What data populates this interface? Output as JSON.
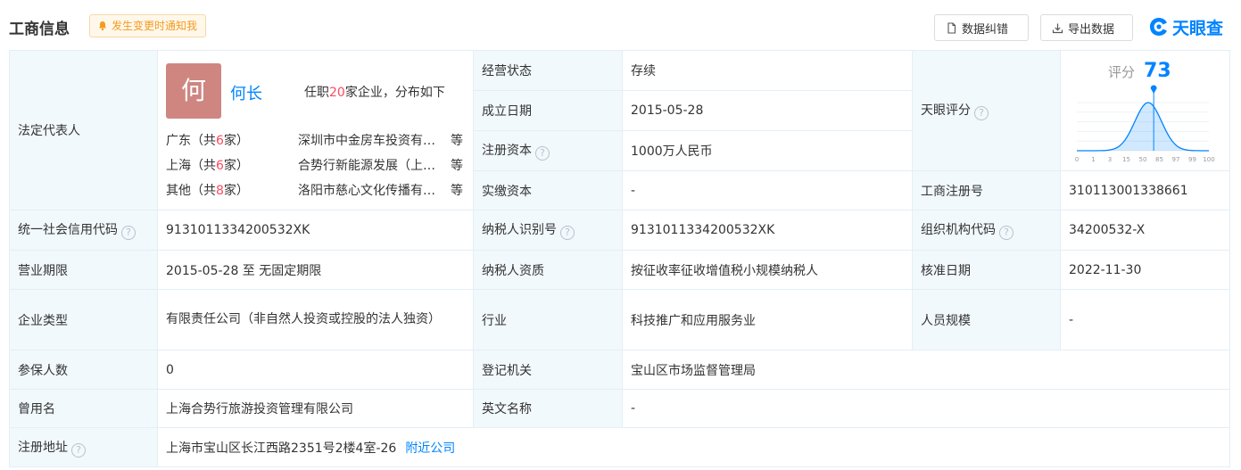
{
  "header": {
    "title": "工商信息",
    "notify_label": "发生变更时通知我",
    "correct_label": "数据纠错",
    "export_label": "导出数据",
    "logo_text": "天眼查"
  },
  "legal_rep": {
    "label": "法定代表人",
    "avatar_char": "何",
    "name": "何长",
    "summary_pre": "任职",
    "summary_count": "20",
    "summary_post": "家企业，分布如下",
    "regions": [
      {
        "region_pre": "广东（共",
        "count": "6",
        "region_post": "家）",
        "company": "深圳市中金房车投资有限公司",
        "etc": "等"
      },
      {
        "region_pre": "上海（共",
        "count": "6",
        "region_post": "家）",
        "company": "合势行新能源发展（上海）有限公司",
        "etc": "等"
      },
      {
        "region_pre": "其他（共",
        "count": "8",
        "region_post": "家）",
        "company": "洛阳市慈心文化传播有限公司",
        "etc": "等"
      }
    ]
  },
  "score": {
    "label": "天眼评分",
    "score_label": "评分",
    "value": 73,
    "value_text": "73",
    "ticks": [
      "0",
      "1",
      "3",
      "15",
      "50",
      "85",
      "97",
      "99",
      "100"
    ],
    "accent": "#0084ff"
  },
  "fields": {
    "operating_status": {
      "label": "经营状态",
      "value": "存续"
    },
    "established_date": {
      "label": "成立日期",
      "value": "2015-05-28"
    },
    "registered_capital": {
      "label": "注册资本",
      "value": "1000万人民币"
    },
    "paid_capital": {
      "label": "实缴资本",
      "value": "-"
    },
    "business_reg_no": {
      "label": "工商注册号",
      "value": "310113001338661"
    },
    "credit_code": {
      "label": "统一社会信用代码",
      "value": "9131011334200532XK"
    },
    "taxpayer_id": {
      "label": "纳税人识别号",
      "value": "9131011334200532XK"
    },
    "org_code": {
      "label": "组织机构代码",
      "value": "34200532-X"
    },
    "business_term": {
      "label": "营业期限",
      "value": "2015-05-28 至 无固定期限"
    },
    "taxpayer_qual": {
      "label": "纳税人资质",
      "value": "按征收率征收增值税小规模纳税人"
    },
    "approval_date": {
      "label": "核准日期",
      "value": "2022-11-30"
    },
    "company_type": {
      "label": "企业类型",
      "value": "有限责任公司（非自然人投资或控股的法人独资）"
    },
    "industry": {
      "label": "行业",
      "value": "科技推广和应用服务业"
    },
    "staff_size": {
      "label": "人员规模",
      "value": "-"
    },
    "insured_count": {
      "label": "参保人数",
      "value": "0"
    },
    "registration_authority": {
      "label": "登记机关",
      "value": "宝山区市场监督管理局"
    },
    "former_name": {
      "label": "曾用名",
      "value": "上海合势行旅游投资管理有限公司"
    },
    "english_name": {
      "label": "英文名称",
      "value": "-"
    },
    "registered_address": {
      "label": "注册地址",
      "value": "上海市宝山区长江西路2351号2楼4室-26",
      "link": "附近公司"
    }
  }
}
